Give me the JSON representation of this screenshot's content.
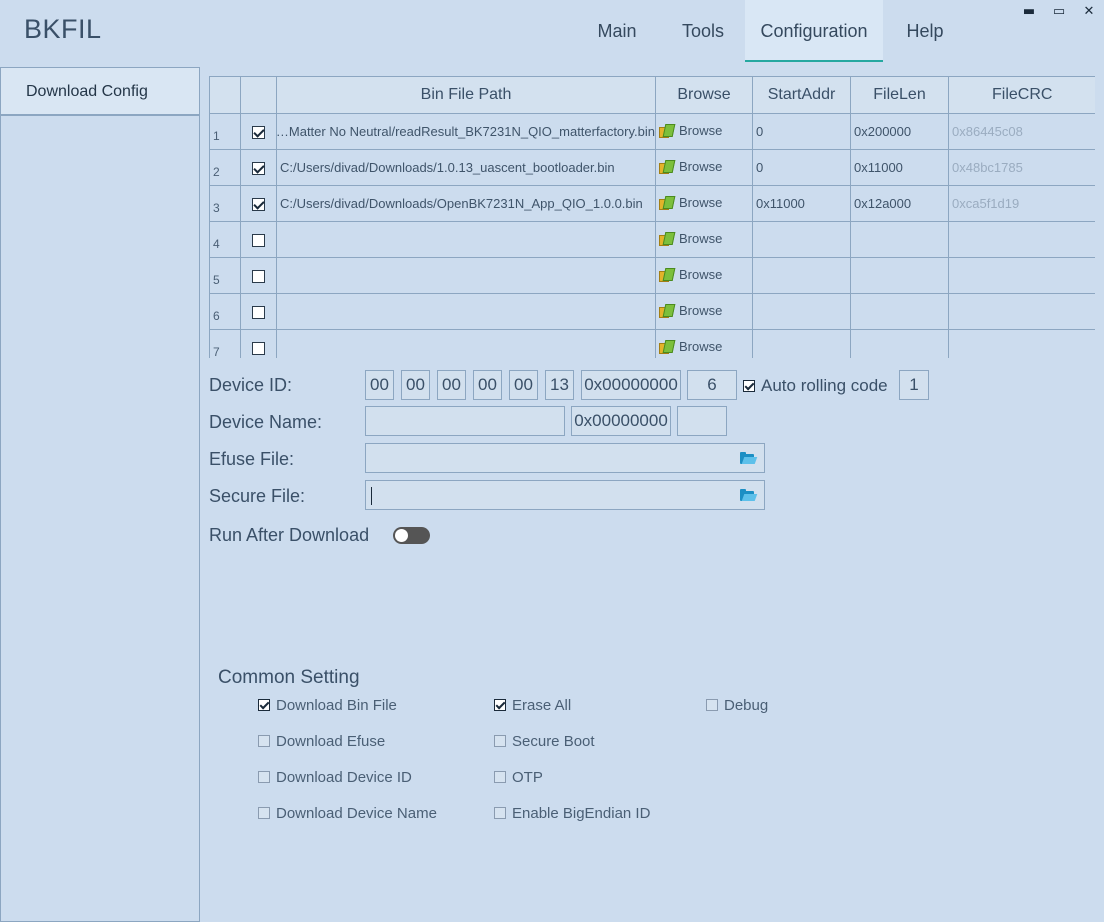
{
  "app": {
    "title": "BKFIL"
  },
  "nav": {
    "tabs": [
      "Main",
      "Tools",
      "Configuration",
      "Help"
    ],
    "active": "Configuration"
  },
  "window": {
    "minimize": "▬",
    "maximize": "▭",
    "close": "✕"
  },
  "sidebar": {
    "items": [
      {
        "label": "Download Config"
      }
    ]
  },
  "table": {
    "headers": [
      "",
      "",
      "Bin File Path",
      "Browse",
      "StartAddr",
      "FileLen",
      "FileCRC"
    ],
    "browse_label": "Browse",
    "rows": [
      {
        "num": "1",
        "checked": true,
        "path": "…Matter No Neutral/readResult_BK7231N_QIO_matterfactory.bin",
        "start": "0",
        "len": "0x200000",
        "crc": "0x86445c08"
      },
      {
        "num": "2",
        "checked": true,
        "path": "C:/Users/divad/Downloads/1.0.13_uascent_bootloader.bin",
        "start": "0",
        "len": "0x11000",
        "crc": "0x48bc1785"
      },
      {
        "num": "3",
        "checked": true,
        "path": "C:/Users/divad/Downloads/OpenBK7231N_App_QIO_1.0.0.bin",
        "start": "0x11000",
        "len": "0x12a000",
        "crc": "0xca5f1d19"
      },
      {
        "num": "4",
        "checked": false,
        "path": "",
        "start": "",
        "len": "",
        "crc": ""
      },
      {
        "num": "5",
        "checked": false,
        "path": "",
        "start": "",
        "len": "",
        "crc": ""
      },
      {
        "num": "6",
        "checked": false,
        "path": "",
        "start": "",
        "len": "",
        "crc": ""
      },
      {
        "num": "7",
        "checked": false,
        "path": "",
        "start": "",
        "len": "",
        "crc": ""
      }
    ]
  },
  "form": {
    "device_id": {
      "label": "Device ID:",
      "bytes": [
        "00",
        "00",
        "00",
        "00",
        "00",
        "13"
      ],
      "addr": "0x00000000",
      "len": "6",
      "auto_rolling_label": "Auto rolling code",
      "auto_rolling_checked": true,
      "step": "1"
    },
    "device_name": {
      "label": "Device Name:",
      "value": "",
      "addr": "0x00000000",
      "len": ""
    },
    "efuse_file": {
      "label": "Efuse File:",
      "value": ""
    },
    "secure_file": {
      "label": "Secure File:",
      "value": ""
    },
    "run_after_download": {
      "label": "Run After Download",
      "enabled": false
    }
  },
  "common": {
    "title": "Common Setting",
    "options": [
      {
        "label": "Download Bin File",
        "checked": true
      },
      {
        "label": "Download Efuse",
        "checked": false
      },
      {
        "label": "Download Device ID",
        "checked": false
      },
      {
        "label": "Download Device Name",
        "checked": false
      },
      {
        "label": "Erase All",
        "checked": true
      },
      {
        "label": "Secure Boot",
        "checked": false
      },
      {
        "label": "OTP",
        "checked": false
      },
      {
        "label": "Enable BigEndian ID",
        "checked": false
      },
      {
        "label": "Debug",
        "checked": false
      }
    ]
  }
}
